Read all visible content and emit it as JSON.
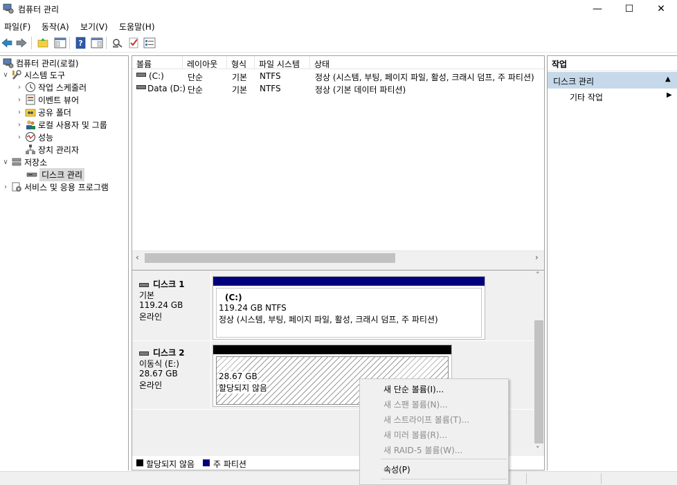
{
  "window": {
    "title": "컴퓨터 관리",
    "minimize": "—",
    "maximize": "☐",
    "close": "✕"
  },
  "menu": [
    "파일(F)",
    "동작(A)",
    "보기(V)",
    "도움말(H)"
  ],
  "tree": {
    "root": "컴퓨터 관리(로컬)",
    "system_tools": "시스템 도구",
    "task_scheduler": "작업 스케줄러",
    "event_viewer": "이벤트 뷰어",
    "shared_folders": "공유 폴더",
    "local_users": "로컬 사용자 및 그룹",
    "performance": "성능",
    "device_manager": "장치 관리자",
    "storage": "저장소",
    "disk_management": "디스크 관리",
    "services": "서비스 및 응용 프로그램"
  },
  "volumes": {
    "columns": [
      "볼륨",
      "레이아웃",
      "형식",
      "파일 시스템",
      "상태"
    ],
    "rows": [
      {
        "volume": "(C:)",
        "layout": "단순",
        "type": "기본",
        "fs": "NTFS",
        "status": "정상 (시스템, 부팅, 페이지 파일, 활성, 크래시 덤프, 주 파티션)"
      },
      {
        "volume": "Data (D:)",
        "layout": "단순",
        "type": "기본",
        "fs": "NTFS",
        "status": "정상 (기본 데이터 파티션)"
      }
    ]
  },
  "disks": [
    {
      "name": "디스크 1",
      "kind": "기본",
      "size": "119.24 GB",
      "state": "온라인",
      "partition": {
        "label": "(C:)",
        "size_fs": "119.24 GB NTFS",
        "status": "정상 (시스템, 부팅, 페이지 파일, 활성, 크래시 덤프, 주 파티션)"
      }
    },
    {
      "name": "디스크 2",
      "kind": "이동식 (E:)",
      "size": "28.67 GB",
      "state": "온라인",
      "partition": {
        "size": "28.67 GB",
        "status": "할당되지 않음"
      }
    }
  ],
  "legend": {
    "unallocated": "할당되지 않음",
    "primary": "주 파티션"
  },
  "actions": {
    "header": "작업",
    "section": "디스크 관리",
    "more": "기타 작업"
  },
  "context_menu": {
    "new_simple": "새 단순 볼륨(I)...",
    "new_spanned": "새 스팬 볼륨(N)...",
    "new_striped": "새 스트라이프 볼륨(T)...",
    "new_mirrored": "새 미러 볼륨(R)...",
    "new_raid5": "새 RAID-5 볼륨(W)...",
    "properties": "속성(P)"
  },
  "colors": {
    "primary": "#00007f",
    "unallocated": "#000000",
    "action_section": "#c6d9ea"
  }
}
